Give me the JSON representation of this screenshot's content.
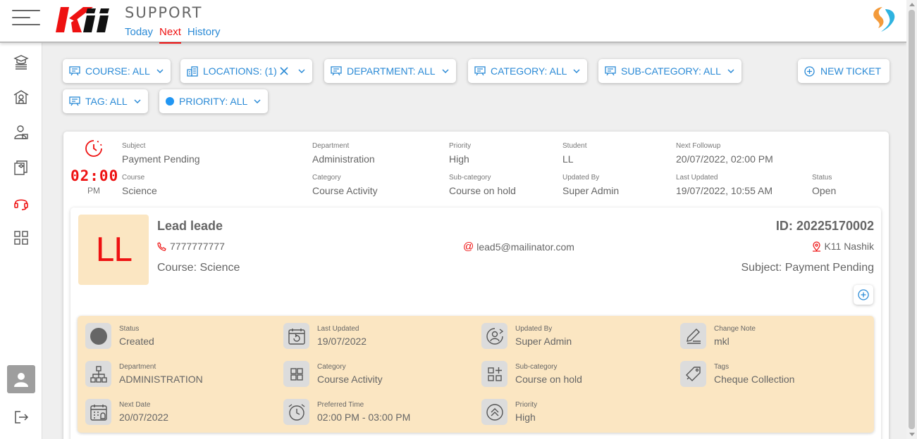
{
  "header": {
    "logo_text": "Kii",
    "title": "SUPPORT",
    "tabs": [
      {
        "label": "Today",
        "active": false
      },
      {
        "label": "Next",
        "active": true
      },
      {
        "label": "History",
        "active": false
      }
    ]
  },
  "sidebar": {
    "items": [
      {
        "icon": "graduation-cap-stack-icon"
      },
      {
        "icon": "school-icon"
      },
      {
        "icon": "user-badge-icon"
      },
      {
        "icon": "books-icon"
      },
      {
        "icon": "headset-icon",
        "active": true
      },
      {
        "icon": "grid-icon"
      }
    ],
    "avatar_icon": "user-icon",
    "logout_icon": "logout-icon"
  },
  "filters": [
    {
      "label": "COURSE: ALL",
      "icon": "presentation-icon"
    },
    {
      "label": "LOCATIONS: (1)",
      "icon": "buildings-icon",
      "clearable": true
    },
    {
      "label": "DEPARTMENT: ALL",
      "icon": "presentation-icon"
    },
    {
      "label": "CATEGORY: ALL",
      "icon": "presentation-icon"
    },
    {
      "label": "SUB-CATEGORY: ALL",
      "icon": "presentation-icon"
    },
    {
      "label": "TAG: ALL",
      "icon": "presentation-icon"
    },
    {
      "label": "PRIORITY: ALL",
      "icon": "blue-dot"
    }
  ],
  "new_ticket_label": "NEW TICKET",
  "ticket": {
    "time": "02:00",
    "ampm": "PM",
    "fields": [
      {
        "label": "Subject",
        "value": "Payment Pending"
      },
      {
        "label": "Department",
        "value": "Administration"
      },
      {
        "label": "Priority",
        "value": "High"
      },
      {
        "label": "Student",
        "value": "LL"
      },
      {
        "label": "Next Followup",
        "value": "20/07/2022, 02:00 PM"
      },
      {
        "label": "Course",
        "value": "Science"
      },
      {
        "label": "Category",
        "value": "Course Activity"
      },
      {
        "label": "Sub-category",
        "value": "Course on hold"
      },
      {
        "label": "Updated By",
        "value": "Super Admin"
      },
      {
        "label": "Last Updated",
        "value": "19/07/2022, 10:55 AM"
      },
      {
        "label": "Status",
        "value": "Open"
      }
    ]
  },
  "lead": {
    "initials": "LL",
    "name": "Lead leade",
    "phone": "7777777777",
    "course": "Course: Science",
    "email": "lead5@mailinator.com",
    "id": "ID: 20225170002",
    "location": "K11 Nashik",
    "subject": "Subject: Payment Pending"
  },
  "details": [
    {
      "label": "Status",
      "value": "Created",
      "icon": "status-dot-icon"
    },
    {
      "label": "Last Updated",
      "value": "19/07/2022",
      "icon": "calendar-refresh-icon"
    },
    {
      "label": "Updated By",
      "value": "Super Admin",
      "icon": "user-refresh-icon"
    },
    {
      "label": "Change Note",
      "value": "mkl",
      "icon": "edit-note-icon"
    },
    {
      "label": "Department",
      "value": "ADMINISTRATION",
      "icon": "hierarchy-icon"
    },
    {
      "label": "Category",
      "value": "Course Activity",
      "icon": "grid-icon"
    },
    {
      "label": "Sub-category",
      "value": "Course on hold",
      "icon": "grid-plus-icon"
    },
    {
      "label": "Tags",
      "value": "Cheque Collection",
      "icon": "tags-icon"
    },
    {
      "label": "Next Date",
      "value": "20/07/2022",
      "icon": "calendar-alarm-icon"
    },
    {
      "label": "Preferred Time",
      "value": "02:00 PM - 03:00 PM",
      "icon": "alarm-clock-icon"
    },
    {
      "label": "Priority",
      "value": "High",
      "icon": "chevrons-up-icon"
    }
  ],
  "colors": {
    "accent": "#2a8ad6",
    "brand_red": "#e11111",
    "panel_bg": "#fbe6c2"
  }
}
